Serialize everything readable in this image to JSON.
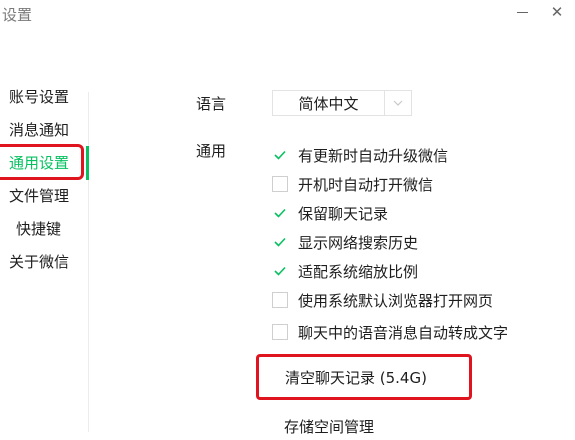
{
  "window": {
    "title": "设置",
    "minimize_icon": "minimize-icon",
    "close_glyph": "✕"
  },
  "sidebar": {
    "items": [
      {
        "label": "账号设置",
        "active": false
      },
      {
        "label": "消息通知",
        "active": false
      },
      {
        "label": "通用设置",
        "active": true
      },
      {
        "label": "文件管理",
        "active": false
      },
      {
        "label": "快捷键",
        "active": false
      },
      {
        "label": "关于微信",
        "active": false
      }
    ]
  },
  "language": {
    "label": "语言",
    "selected": "简体中文",
    "icon": "chevron-down-icon"
  },
  "general": {
    "label": "通用",
    "options": [
      {
        "label": "有更新时自动升级微信",
        "checked": true
      },
      {
        "label": "开机时自动打开微信",
        "checked": false
      },
      {
        "label": "保留聊天记录",
        "checked": true
      },
      {
        "label": "显示网络搜索历史",
        "checked": true
      },
      {
        "label": "适配系统缩放比例",
        "checked": true
      },
      {
        "label": "使用系统默认浏览器打开网页",
        "checked": false
      },
      {
        "label": "聊天中的语音消息自动转成文字",
        "checked": false
      }
    ]
  },
  "actions": {
    "clear_history": "清空聊天记录 (5.4G)",
    "storage_management": "存储空间管理"
  },
  "colors": {
    "accent": "#07c160",
    "highlight_box": "#e0141e"
  }
}
